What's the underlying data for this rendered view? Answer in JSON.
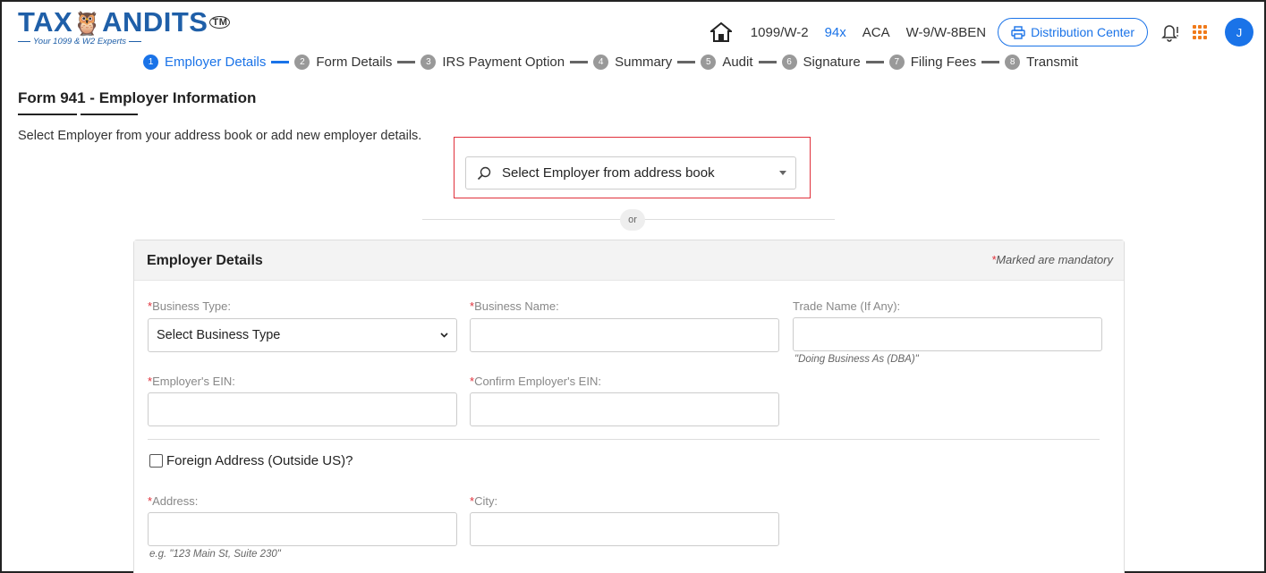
{
  "header": {
    "logo": {
      "brand": "TAXBANDITS",
      "tagline": "Your 1099 & W2 Experts"
    },
    "nav": [
      {
        "label": "1099/W-2",
        "active": false
      },
      {
        "label": "94x",
        "active": true
      },
      {
        "label": "ACA",
        "active": false
      },
      {
        "label": "W-9/W-8BEN",
        "active": false
      }
    ],
    "distribution_label": "Distribution Center",
    "avatar_initial": "J",
    "accent_color": "#1a73e8",
    "brand_orange": "#f07a1a"
  },
  "stepper": [
    {
      "num": "1",
      "label": "Employer Details",
      "active": true
    },
    {
      "num": "2",
      "label": "Form Details",
      "active": false
    },
    {
      "num": "3",
      "label": "IRS Payment Option",
      "active": false
    },
    {
      "num": "4",
      "label": "Summary",
      "active": false
    },
    {
      "num": "5",
      "label": "Audit",
      "active": false
    },
    {
      "num": "6",
      "label": "Signature",
      "active": false
    },
    {
      "num": "7",
      "label": "Filing Fees",
      "active": false
    },
    {
      "num": "8",
      "label": "Transmit",
      "active": false
    }
  ],
  "page": {
    "title": "Form 941 - Employer Information",
    "instruction": "Select Employer from your address book or add new employer details.",
    "search_placeholder": "Select Employer from address book",
    "or_label": "or"
  },
  "card": {
    "title": "Employer Details",
    "mandatory_star": "*",
    "mandatory_note": "Marked are mandatory",
    "fields": {
      "business_type": {
        "label": "Business Type:",
        "required": true,
        "value": "Select Business Type"
      },
      "business_name": {
        "label": "Business Name:",
        "required": true,
        "value": ""
      },
      "trade_name": {
        "label": "Trade Name (If Any):",
        "required": false,
        "hint": "\"Doing Business As (DBA)\""
      },
      "ein": {
        "label": "Employer's EIN:",
        "required": true
      },
      "confirm_ein": {
        "label": "Confirm Employer's EIN:",
        "required": true
      },
      "foreign_address": {
        "label": "Foreign Address (Outside US)?",
        "checked": false
      },
      "address": {
        "label": "Address:",
        "required": true,
        "hint": "e.g. \"123 Main St, Suite 230\""
      },
      "city": {
        "label": "City:",
        "required": true
      }
    }
  }
}
